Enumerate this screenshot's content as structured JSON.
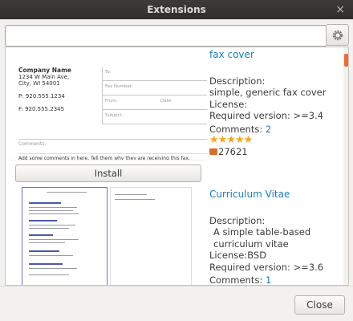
{
  "window": {
    "title": "Extensions"
  },
  "search": {
    "value": "",
    "placeholder": ""
  },
  "extensions": [
    {
      "name": "fax cover",
      "description_label": "Description:",
      "description": "simple, generic fax cover",
      "license_label": "License:",
      "license": "",
      "required_version": "Required version: >=3.4",
      "comments_label": "Comments:",
      "comments": "2",
      "rating": 5,
      "downloads": "27621",
      "install_label": "Install",
      "preview": {
        "company": "Company Name",
        "address1": "1234 W Main Ave,",
        "address2": "City, WI 54001",
        "phone": "P: 920.555.1234",
        "fax": "F: 920.555.2345",
        "to": "To:",
        "fax_number": "Fax Number:",
        "from": "From:",
        "date": "Date:",
        "subject": "Subject:",
        "comments": "Comments:",
        "message": "Add some comments in here. Tell them why they are receiving this fax."
      }
    },
    {
      "name": "Curriculum Vitae",
      "description_label": "Description:",
      "description": "A simple table-based curriculum vitae",
      "license_label": "License:",
      "license": "BSD",
      "required_version": "Required version: >=3.6",
      "comments_label": "Comments:",
      "comments": "1"
    }
  ],
  "footer": {
    "close_label": "Close"
  },
  "colors": {
    "accent": "#1a7cbf",
    "scroll_thumb": "#ee6b33",
    "titlebar": "#3c3b37"
  }
}
